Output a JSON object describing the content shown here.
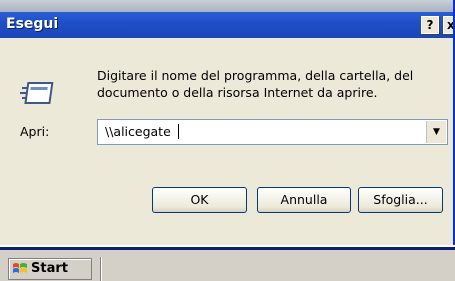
{
  "dialog": {
    "title": "Esegui",
    "help_glyph": "?",
    "close_glyph": "x",
    "description": "Digitare il nome del programma, della cartella, del documento o della risorsa Internet da aprire.",
    "open_label": "Apri:",
    "open_value": "\\\\alicegate",
    "dropdown_glyph": "▼",
    "buttons": {
      "ok": "OK",
      "cancel": "Annulla",
      "browse": "Sfoglia..."
    },
    "icon": "run-icon"
  },
  "taskbar": {
    "start_label": "Start",
    "start_icon": "windows-flag-icon"
  },
  "colors": {
    "titlebar": "#1f4fc8",
    "window_bg": "#ece9d8",
    "taskbar_bg": "#d4d0c8"
  }
}
